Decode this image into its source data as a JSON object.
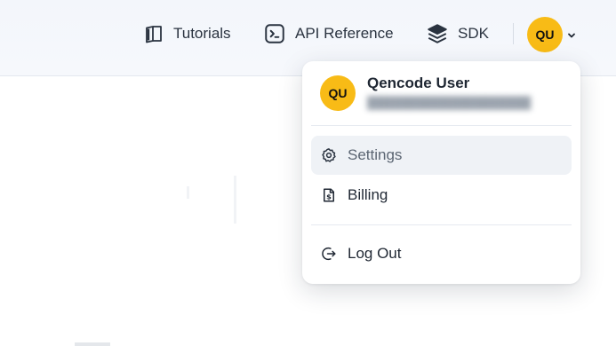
{
  "header": {
    "links": [
      {
        "label": "Tutorials",
        "icon": "book-icon"
      },
      {
        "label": "API Reference",
        "icon": "terminal-icon"
      },
      {
        "label": "SDK",
        "icon": "layers-icon"
      }
    ],
    "avatar_initials": "QU"
  },
  "user_menu": {
    "avatar_initials": "QU",
    "user_name": "Qencode User",
    "items": [
      {
        "label": "Settings",
        "icon": "gear-icon",
        "active": true
      },
      {
        "label": "Billing",
        "icon": "billing-icon",
        "active": false
      },
      {
        "label": "Log Out",
        "icon": "logout-icon",
        "active": false
      }
    ]
  },
  "colors": {
    "avatar_bg": "#f8bb16",
    "header_bg": "#f3f6fb",
    "active_item_bg": "#eff2f6"
  }
}
